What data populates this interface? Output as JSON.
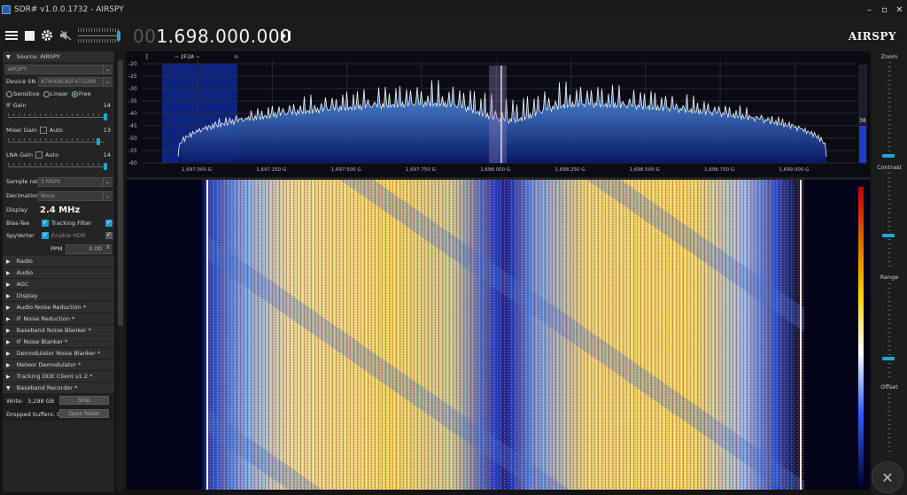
{
  "window": {
    "title": "SDR# v1.0.0.1732 - AIRSPY",
    "minimize": "–",
    "maximize": "▫",
    "close": "✕"
  },
  "toolbar": {
    "menu_icon": "menu-icon",
    "stop_icon": "stop-icon",
    "settings_icon": "gear-icon",
    "mute_icon": "speaker-muted-icon",
    "freq_dim": "00",
    "freq_value": "1.698.000.000",
    "tune_icon": "step-tune-icon",
    "brand": "AIRSPY"
  },
  "source": {
    "header": "Source: AIRSPY",
    "device": "AIRSPY",
    "device_sn_label": "Device SN",
    "device_sn": "A74068C82F471D90",
    "modes": [
      "Sensitive",
      "Linear",
      "Free"
    ],
    "mode_selected": "Free",
    "if_gain_label": "IF Gain",
    "if_gain_value": "14",
    "mixer_gain_label": "Mixer Gain",
    "mixer_auto": "Auto",
    "mixer_gain_value": "13",
    "lna_gain_label": "LNA Gain",
    "lna_auto": "Auto",
    "lna_gain_value": "14",
    "sample_rate_label": "Sample rate",
    "sample_rate": "3 MSPS",
    "decimation_label": "Decimation",
    "decimation": "None",
    "display_label": "Display",
    "display_value": "2.4 MHz",
    "bias_tee_label": "Bias-Tee",
    "tracking_filter_label": "Tracking Filter",
    "spyverter_label": "SpyVerter",
    "enable_hdr_label": "Enable HDR",
    "ppm_label": "PPM",
    "ppm_value": "0.00"
  },
  "sections": [
    "Radio",
    "Audio",
    "AGC",
    "Display",
    "Audio Noise Reduction *",
    "IF Noise Reduction *",
    "Baseband Noise Blanker *",
    "IF Noise Blanker *",
    "Demodulator Noise Blanker *",
    "Meteor Demodulator *",
    "Tracking DDE Client v1.2 *"
  ],
  "recorder": {
    "header": "Baseband Recorder *",
    "write_label": "Write:",
    "write_value": "3,298 GB",
    "stop_button": "Stop",
    "dropped_label": "Dropped buffers:",
    "dropped_value": "0",
    "open_folder_button": "Open folder"
  },
  "spectrum": {
    "y_ticks": [
      "-20",
      "-25",
      "-30",
      "-35",
      "-40",
      "-45",
      "-50",
      "-55",
      "-60"
    ],
    "x_ticks": [
      "1,697.000 G",
      "1,697.250 G",
      "1,697.500 G",
      "1,697.750 G",
      "1,698.000 G",
      "1,698.250 G",
      "1,698.500 G",
      "1,698.750 G",
      "1,699.000 G"
    ],
    "top_labels": [
      "[",
      "~ 2F2A ~",
      "n"
    ],
    "level_value": "38"
  },
  "right_panel": {
    "zoom": "Zoom",
    "contrast": "Contrast",
    "range": "Range",
    "offset": "Offset"
  },
  "colors": {
    "accent": "#1ea7d6",
    "waterfall_low": "#0a1a8c",
    "waterfall_high": "#f2d65a"
  }
}
